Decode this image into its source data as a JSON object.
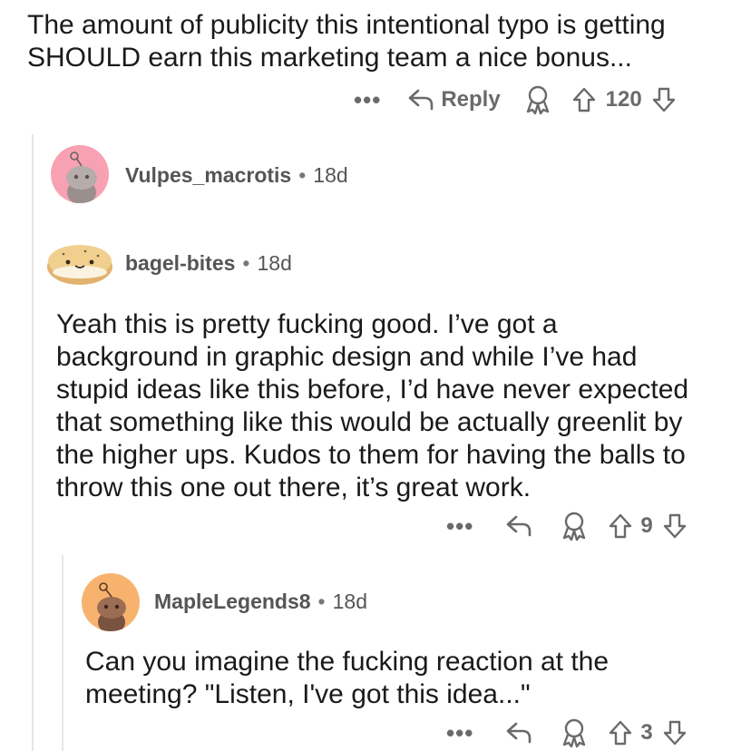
{
  "top_comment": {
    "text_line1": "The amount of publicity this intentional typo is getting",
    "text_line2": "SHOULD earn this marketing team a nice bonus...",
    "actions": {
      "more": "•••",
      "reply": "Reply",
      "score": "120"
    }
  },
  "collapsed_comment": {
    "username": "Vulpes_macrotis",
    "separator": "•",
    "time": "18d"
  },
  "comment_bagel": {
    "username": "bagel-bites",
    "separator": "•",
    "time": "18d",
    "lines": [
      "Yeah this is pretty fucking good. I’ve got a",
      "background in graphic design and while I’ve had",
      "stupid ideas like this before, I’d have never expected",
      "that something like this would be actually greenlit by",
      "the higher ups. Kudos to them for having the balls to",
      "throw this one out there, it’s great work."
    ],
    "actions": {
      "more": "•••",
      "score": "9"
    }
  },
  "comment_maple": {
    "username": "MapleLegends8",
    "separator": "•",
    "time": "18d",
    "lines": [
      "Can you imagine the fucking reaction at the",
      "meeting? \"Listen, I've got this idea...\""
    ],
    "actions": {
      "more": "•••",
      "score": "3"
    }
  },
  "colors": {
    "avatar_pink": "#f7a1b2",
    "avatar_orange": "#f7b36e",
    "thread_line": "#e6e6e6",
    "icon_gray": "#6a6a6a"
  }
}
